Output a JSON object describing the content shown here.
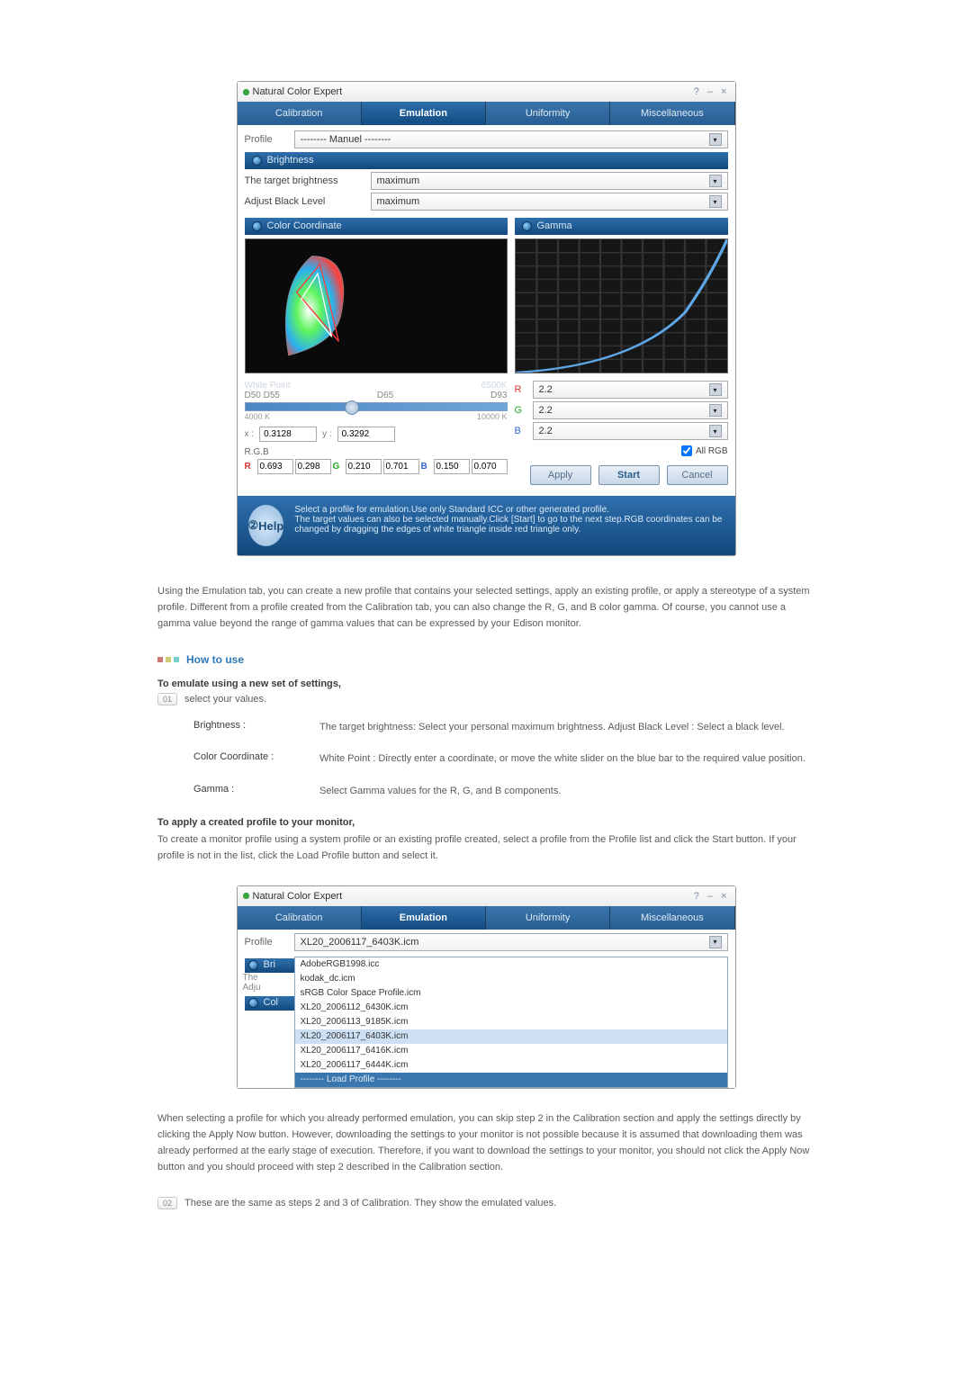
{
  "nce1": {
    "title": "Natural Color Expert",
    "tabs": [
      "Calibration",
      "Emulation",
      "Uniformity",
      "Miscellaneous"
    ],
    "active_tab_index": 1,
    "profile_label": "Profile",
    "profile_value": "-------- Manuel --------",
    "brightness": {
      "header": "Brightness",
      "row1_label": "The target brightness",
      "row1_value": "maximum",
      "row2_label": "Adjust Black Level",
      "row2_value": "maximum"
    },
    "color_coord": {
      "header": "Color Coordinate",
      "white_point_label": "White Point",
      "white_point_k": "6500K",
      "scale_left": "D50 D55",
      "scale_mid": "D65",
      "scale_right": "D93",
      "slider_min": "4000 K",
      "slider_max": "10000 K",
      "x_label": "x :",
      "x_val": "0.3128",
      "y_label": "y :",
      "y_val": "0.3292",
      "rgb_label": "R.G.B",
      "r": {
        "x": "0.693",
        "y": "0.298"
      },
      "g": {
        "x": "0.210",
        "y": "0.701"
      },
      "b": {
        "x": "0.150",
        "y": "0.070"
      }
    },
    "gamma": {
      "header": "Gamma",
      "r": "2.2",
      "g": "2.2",
      "b": "2.2",
      "all_rgb": "All RGB"
    },
    "buttons": {
      "apply": "Apply",
      "start": "Start",
      "cancel": "Cancel"
    },
    "help_label": "Help",
    "help_text": "Select a profile for emulation.Use only Standard ICC or other generated profile.\nThe target values can also be selected manually.Click [Start] to go to the next step.RGB coordinates can be changed by dragging the edges of white triangle inside red triangle only."
  },
  "para1": "Using the Emulation tab, you can create a new profile that contains your selected settings, apply an existing profile, or apply a stereotype of a system profile. Different from a profile created from the Calibration tab, you can also change the R, G, and B color gamma. Of course, you cannot use a gamma value beyond the range of gamma values that can be expressed by your Edison monitor.",
  "howto": "How to use",
  "s1_title": "To emulate using a new set of settings,",
  "s1_step": "select your values.",
  "defs": {
    "brightness": {
      "term": "Brightness :",
      "desc": "The target brightness: Select your personal maximum brightness. Adjust Black Level : Select a black level."
    },
    "color": {
      "term": "Color Coordinate :",
      "desc": "White Point : Directly enter a coordinate, or move the white slider on the blue bar to the required value position."
    },
    "gamma": {
      "term": "Gamma :",
      "desc": "Select Gamma values for the R, G, and B components."
    }
  },
  "s2_title": "To apply a created profile to your monitor,",
  "s2_para": "To create a monitor profile using a system profile or an existing profile created, select a profile from the Profile list and click the Start button. If your profile is not in the list, click the Load Profile button and select it.",
  "nce2": {
    "title": "Natural Color Expert",
    "tabs": [
      "Calibration",
      "Emulation",
      "Uniformity",
      "Miscellaneous"
    ],
    "active_tab_index": 1,
    "profile_label": "Profile",
    "profile_value": "XL20_2006117_6403K.icm",
    "dd_items": [
      "AdobeRGB1998.icc",
      "kodak_dc.icm",
      "sRGB Color Space Profile.icm",
      "XL20_2006112_6430K.icm",
      "XL20_2006113_9185K.icm",
      "XL20_2006117_6403K.icm",
      "XL20_2006117_6416K.icm",
      "XL20_2006117_6444K.icm",
      "-------- Load Profile --------"
    ],
    "ghost_bri": "Bri",
    "ghost_the": "The",
    "ghost_adj": "Adju",
    "ghost_col": "Col"
  },
  "para2": "When selecting a profile for which you already performed emulation, you can skip step 2 in the Calibration section and apply the settings directly by clicking the Apply Now button. However, downloading the settings to your monitor is not possible because it is assumed that downloading them was already performed at the early stage of execution. Therefore, if you want to download the settings to your monitor, you should not click the Apply Now button and you should proceed with step 2 described in the Calibration section.",
  "step02": "These are the same as steps 2 and 3 of Calibration. They show the emulated values.",
  "num01": "01",
  "num02": "02",
  "winbtns": "?  –  ×"
}
